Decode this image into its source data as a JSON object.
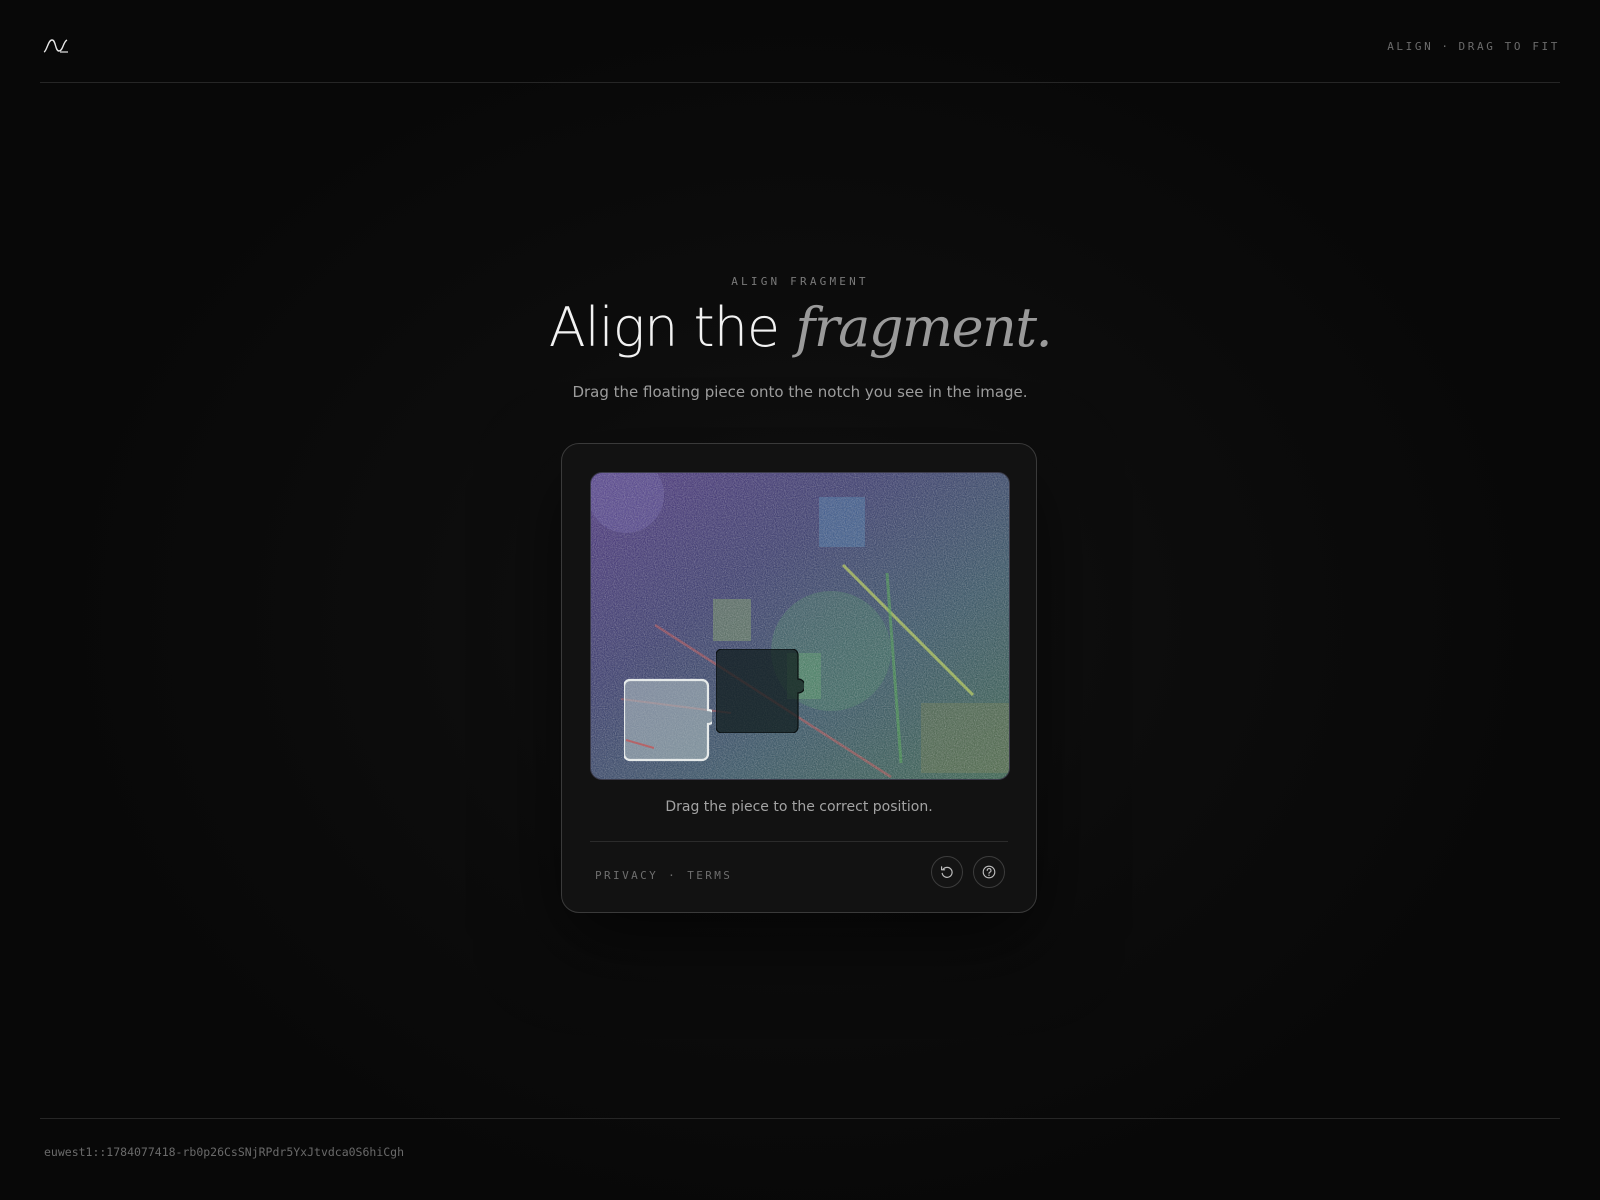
{
  "header": {
    "logo_icon": "wave-logo-icon",
    "hint_action": "ALIGN",
    "hint_separator": "·",
    "hint_detail": "DRAG TO FIT"
  },
  "hero": {
    "eyebrow": "ALIGN FRAGMENT",
    "title_plain": "Align the",
    "title_accent": "fragment.",
    "subtitle": "Drag the floating piece onto the notch you see in the image."
  },
  "captcha": {
    "hint": "Drag the piece to the correct position.",
    "links": {
      "privacy": "PRIVACY",
      "separator": "·",
      "terms": "TERMS"
    },
    "buttons": {
      "refresh_icon": "refresh-icon",
      "help_icon": "help-icon"
    }
  },
  "footer": {
    "session_id": "euwest1::1784077418-rb0p26CsSNjRPdr5YxJtvdca0S6hiCgh"
  },
  "colors": {
    "background": "#080808",
    "card": "#121212",
    "text_primary": "#f2f2f2",
    "text_muted": "#9e9e9e",
    "puzzle_purple": "#3d2a6e",
    "puzzle_green": "#2e5a44"
  }
}
